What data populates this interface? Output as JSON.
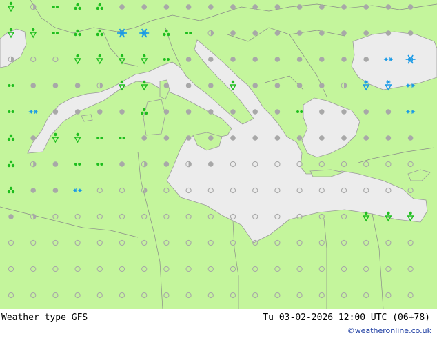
{
  "footer": {
    "left_label": "Weather type   GFS",
    "right_label": "Tu 03-02-2026 12:00 UTC (06+78)",
    "credit": "©weatheronline.co.uk"
  },
  "colors": {
    "land": "#c4f59c",
    "sea": "#ececec",
    "border": "#8a8a8a",
    "symbol_none": "#a8a8a8",
    "symbol_rain": "#1ebe1e",
    "symbol_snow": "#1a9ae6"
  },
  "legend_icons": {
    "dot": "no-weather-dot-icon",
    "half": "few-clouds-half-circle-icon",
    "ring": "clear-sky-circle-icon",
    "drizzle": "drizzle-dots-icon",
    "showers": "rain-showers-icon",
    "shower_drop": "rain-shower-drop-icon",
    "snowflake": "snowflake-icon",
    "snow": "snow-stars-icon",
    "snow_drop": "snow-shower-drop-icon"
  },
  "symbol_grid": {
    "rows": [
      [
        "shower_drop",
        "half",
        "drizzle",
        "showers",
        "showers",
        "dot",
        "dot",
        "dot",
        "dot",
        "dot",
        "dot",
        "dot",
        "dot",
        "dot",
        "dot",
        "dot",
        "dot",
        "dot",
        "dot"
      ],
      [
        "shower_drop",
        "shower_drop",
        "drizzle",
        "showers",
        "showers",
        "snowflake",
        "snowflake",
        "showers",
        "drizzle",
        "half",
        "dot",
        "dot",
        "dot",
        "dot",
        "dot",
        "dot",
        "dot",
        "dot",
        "dot"
      ],
      [
        "half",
        "ring",
        "ring",
        "shower_drop",
        "shower_drop",
        "shower_drop",
        "shower_drop",
        "drizzle",
        "dot",
        "dot",
        "dot",
        "dot",
        "dot",
        "dot",
        "dot",
        "dot",
        "dot",
        "snow",
        "snowflake"
      ],
      [
        "drizzle",
        "dot",
        "dot",
        "dot",
        "half",
        "shower_drop",
        "shower_drop",
        "dot",
        "dot",
        "dot",
        "shower_drop",
        "dot",
        "dot",
        "dot",
        "dot",
        "half",
        "snow_drop",
        "snow_drop",
        "snow"
      ],
      [
        "drizzle",
        "snow",
        "dot",
        "dot",
        "dot",
        "dot",
        "showers",
        "dot",
        "dot",
        "dot",
        "dot",
        "dot",
        "dot",
        "drizzle",
        "dot",
        "dot",
        "dot",
        "dot",
        "snow"
      ],
      [
        "showers",
        "dot",
        "shower_drop",
        "shower_drop",
        "drizzle",
        "drizzle",
        "dot",
        "dot",
        "dot",
        "dot",
        "dot",
        "dot",
        "dot",
        "dot",
        "dot",
        "dot",
        "dot",
        "dot",
        "dot"
      ],
      [
        "showers",
        "half",
        "dot",
        "drizzle",
        "drizzle",
        "dot",
        "half",
        "dot",
        "half",
        "dot",
        "ring",
        "ring",
        "ring",
        "ring",
        "ring",
        "ring",
        "ring",
        "ring",
        "ring"
      ],
      [
        "showers",
        "dot",
        "dot",
        "snow",
        "ring",
        "ring",
        "half",
        "ring",
        "ring",
        "ring",
        "ring",
        "ring",
        "ring",
        "ring",
        "ring",
        "ring",
        "ring",
        "ring",
        "ring"
      ],
      [
        "dot",
        "half",
        "ring",
        "ring",
        "ring",
        "ring",
        "ring",
        "ring",
        "ring",
        "ring",
        "ring",
        "ring",
        "ring",
        "ring",
        "ring",
        "ring",
        "shower_drop",
        "shower_drop",
        "shower_drop"
      ],
      [
        "ring",
        "ring",
        "ring",
        "ring",
        "ring",
        "ring",
        "ring",
        "ring",
        "ring",
        "ring",
        "ring",
        "ring",
        "ring",
        "ring",
        "ring",
        "ring",
        "ring",
        "ring",
        "ring"
      ],
      [
        "ring",
        "ring",
        "ring",
        "ring",
        "ring",
        "ring",
        "ring",
        "ring",
        "ring",
        "ring",
        "ring",
        "ring",
        "ring",
        "ring",
        "ring",
        "ring",
        "ring",
        "ring",
        "ring"
      ],
      [
        "ring",
        "ring",
        "ring",
        "ring",
        "ring",
        "ring",
        "ring",
        "ring",
        "ring",
        "ring",
        "ring",
        "ring",
        "ring",
        "ring",
        "ring",
        "ring",
        "ring",
        "ring",
        "ring"
      ]
    ]
  }
}
